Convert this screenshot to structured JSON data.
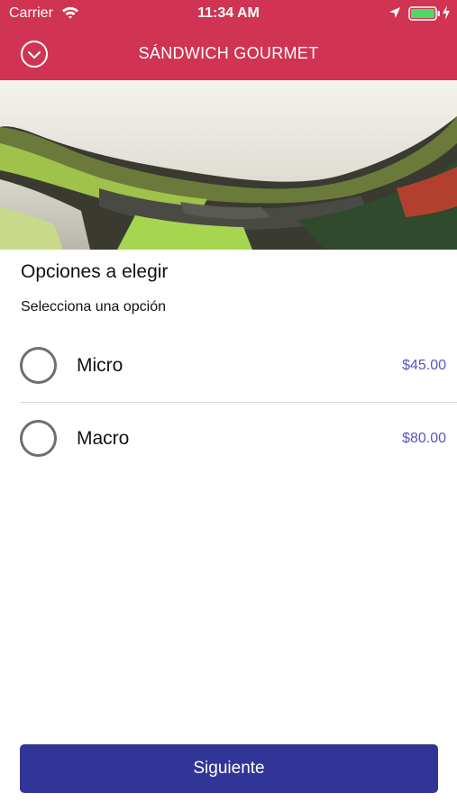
{
  "status_bar": {
    "carrier": "Carrier",
    "time": "11:34 AM",
    "icons": [
      "wifi-icon",
      "location-icon",
      "battery-icon",
      "charging-bolt-icon"
    ]
  },
  "nav": {
    "title": "SÁNDWICH GOURMET",
    "back_icon": "chevron-down-circle-icon"
  },
  "colors": {
    "header": "#d03452",
    "price": "#5757c2",
    "primary_button": "#313598",
    "radio_border": "#6e6e6e"
  },
  "content": {
    "section_title": "Opciones a elegir",
    "section_subtitle": "Selecciona una opción",
    "options": [
      {
        "label": "Micro",
        "price": "$45.00",
        "selected": false
      },
      {
        "label": "Macro",
        "price": "$80.00",
        "selected": false
      }
    ]
  },
  "footer": {
    "next_label": "Siguiente"
  }
}
